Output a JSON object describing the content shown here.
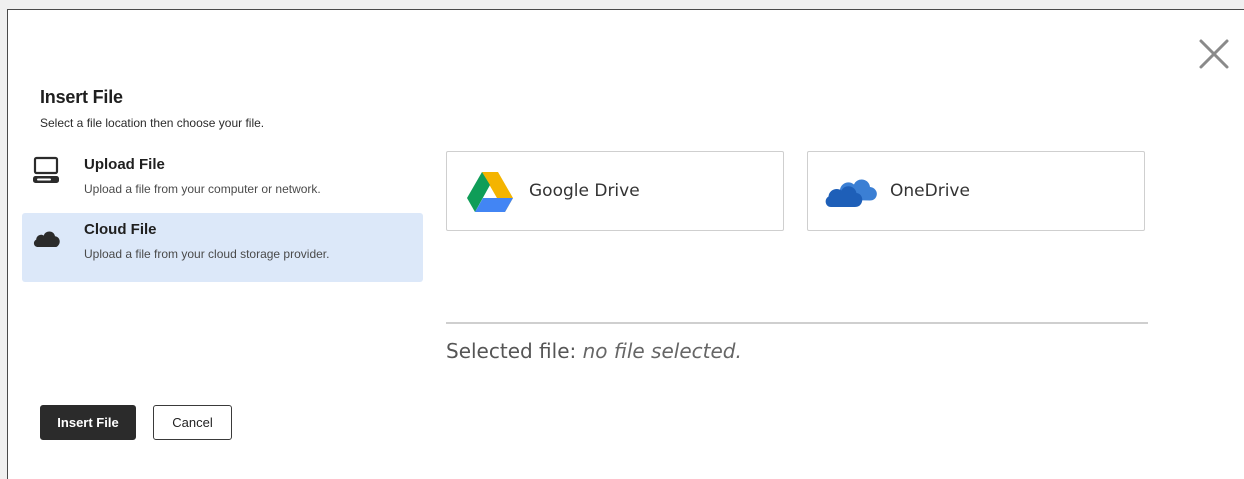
{
  "dialog": {
    "title": "Insert File",
    "subtitle": "Select a file location then choose your file."
  },
  "locations": [
    {
      "label": "Upload File",
      "description": "Upload a file from your computer or network.",
      "icon": "computer-icon",
      "selected": false
    },
    {
      "label": "Cloud File",
      "description": "Upload a file from your cloud storage provider.",
      "icon": "cloud-icon",
      "selected": true
    }
  ],
  "providers": [
    {
      "name": "Google Drive",
      "icon": "google-drive-icon"
    },
    {
      "name": "OneDrive",
      "icon": "onedrive-icon"
    }
  ],
  "selection": {
    "label": "Selected file:",
    "value": "no file selected."
  },
  "buttons": {
    "insert": "Insert File",
    "cancel": "Cancel"
  },
  "colors": {
    "selected_bg": "#dce8f9",
    "primary_button": "#2b2b2b",
    "onedrive_blue": "#1e5fb8"
  }
}
